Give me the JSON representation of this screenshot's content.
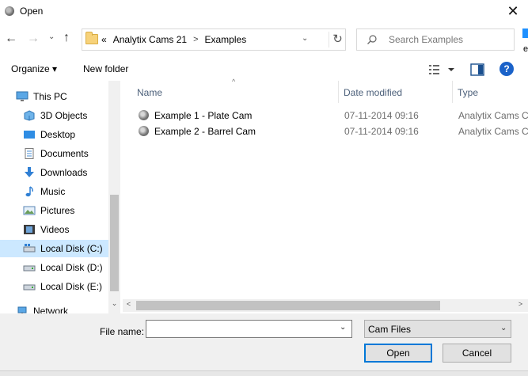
{
  "window": {
    "title": "Open",
    "close_glyph": "✕"
  },
  "nav": {
    "back_glyph": "←",
    "forward_glyph": "→",
    "recent_glyph": "⌄",
    "up_glyph": "↑"
  },
  "address": {
    "overflow": "«",
    "crumbs": [
      "Analytix Cams 21",
      "Examples"
    ],
    "separator": ">",
    "dropdown_glyph": "⌄",
    "refresh_glyph": "↻"
  },
  "search": {
    "placeholder": "Search Examples"
  },
  "edge": {
    "fragment": "e"
  },
  "toolbar": {
    "organize_label": "Organize ▾",
    "new_folder_label": "New folder",
    "help_label": "?"
  },
  "sidebar": {
    "items": [
      {
        "label": "This PC",
        "icon": "pc-icon"
      },
      {
        "label": "3D Objects",
        "icon": "cube-icon"
      },
      {
        "label": "Desktop",
        "icon": "desktop-icon"
      },
      {
        "label": "Documents",
        "icon": "document-icon"
      },
      {
        "label": "Downloads",
        "icon": "download-icon"
      },
      {
        "label": "Music",
        "icon": "music-icon"
      },
      {
        "label": "Pictures",
        "icon": "pictures-icon"
      },
      {
        "label": "Videos",
        "icon": "video-icon"
      },
      {
        "label": "Local Disk (C:)",
        "icon": "drive-icon",
        "selected": true
      },
      {
        "label": "Local Disk (D:)",
        "icon": "drive-icon"
      },
      {
        "label": "Local Disk (E:)",
        "icon": "drive-icon"
      },
      {
        "label": "Network",
        "icon": "network-icon"
      }
    ]
  },
  "filelist": {
    "columns": [
      "Name",
      "Date modified",
      "Type"
    ],
    "sort_glyph": "^",
    "rows": [
      {
        "name": "Example 1 - Plate Cam",
        "date": "07-11-2014 09:16",
        "type": "Analytix Cams C"
      },
      {
        "name": "Example 2 - Barrel Cam",
        "date": "07-11-2014 09:16",
        "type": "Analytix Cams C"
      }
    ]
  },
  "scroll": {
    "up": "▲",
    "down": "⌄",
    "left": "<",
    "right": ">"
  },
  "footer": {
    "filename_label": "File name:",
    "filename_value": "",
    "filename_dd": "⌄",
    "filetype_value": "Cam Files",
    "filetype_dd": "⌄",
    "open_label": "Open",
    "cancel_label": "Cancel"
  },
  "colors": {
    "accent": "#0078d7",
    "selection": "#cce8ff",
    "help": "#1a62c9"
  }
}
